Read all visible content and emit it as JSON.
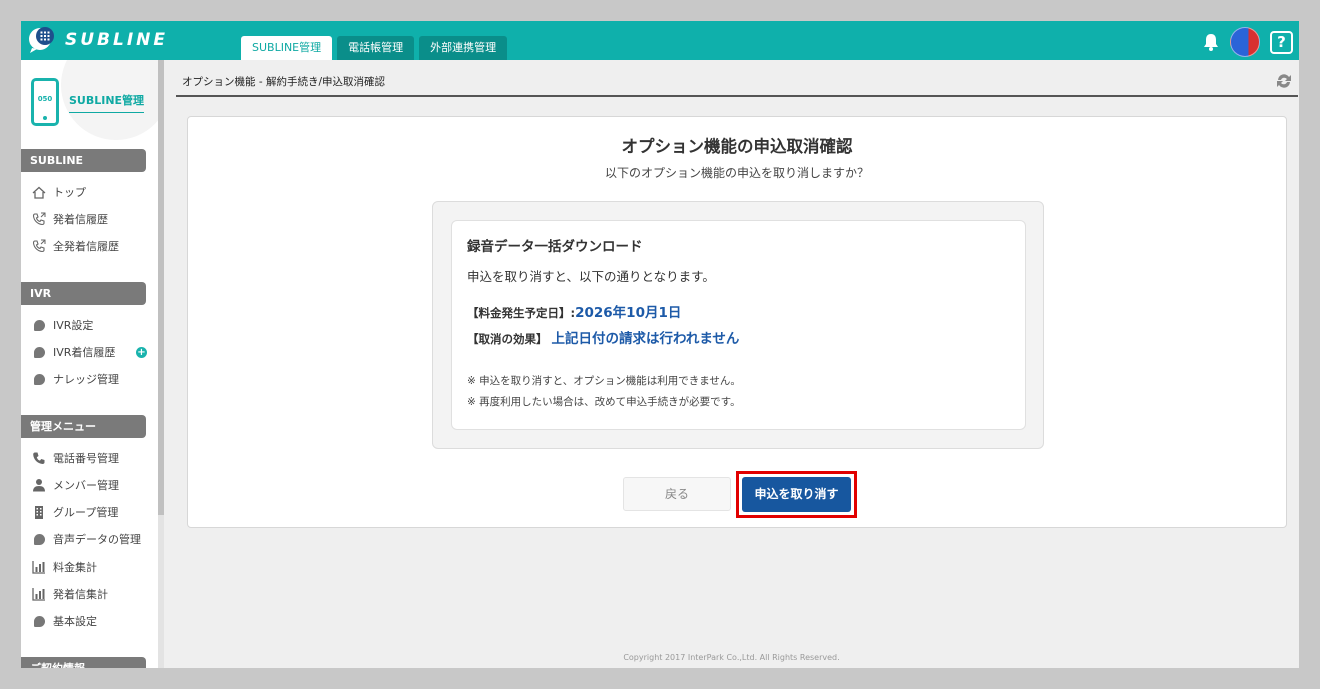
{
  "app": {
    "logo_text": "SUBLINE",
    "tabs": [
      {
        "label": "SUBLINE管理",
        "active": true
      },
      {
        "label": "電話帳管理",
        "active": false
      },
      {
        "label": "外部連携管理",
        "active": false
      }
    ],
    "help_label": "?"
  },
  "sidebar": {
    "brand_number": "050",
    "brand_label": "SUBLINE管理",
    "sections": [
      {
        "header": "SUBLINE",
        "items": [
          {
            "label": "トップ",
            "icon": "home-icon"
          },
          {
            "label": "発着信履歴",
            "icon": "phone-call-icon"
          },
          {
            "label": "全発着信履歴",
            "icon": "phone-call-icon"
          }
        ]
      },
      {
        "header": "IVR",
        "items": [
          {
            "label": "IVR設定",
            "icon": "bubble-icon"
          },
          {
            "label": "IVR着信履歴",
            "icon": "bubble-icon"
          },
          {
            "label": "ナレッジ管理",
            "icon": "bubble-icon"
          }
        ]
      },
      {
        "header": "管理メニュー",
        "items": [
          {
            "label": "電話番号管理",
            "icon": "phone-icon"
          },
          {
            "label": "メンバー管理",
            "icon": "person-icon"
          },
          {
            "label": "グループ管理",
            "icon": "building-icon"
          },
          {
            "label": "音声データの管理",
            "icon": "bubble-icon"
          },
          {
            "label": "料金集計",
            "icon": "bar-chart-icon"
          },
          {
            "label": "発着信集計",
            "icon": "bar-chart-icon"
          },
          {
            "label": "基本設定",
            "icon": "bubble-icon"
          }
        ]
      },
      {
        "header": "ご契約情報"
      }
    ]
  },
  "breadcrumb": "オプション機能 - 解約手続き/申込取消確認",
  "dialog": {
    "title": "オプション機能の申込取消確認",
    "subtitle": "以下のオプション機能の申込を取り消しますか？",
    "card": {
      "title": "録音データ一括ダウンロード",
      "description": "申込を取り消すと、以下の通りとなります。",
      "fields": [
        {
          "key": "【料金発生予定日】:",
          "value": "2026年10月1日"
        },
        {
          "key": "【取消の効果】",
          "value": "上記日付の請求は行われません"
        }
      ],
      "notes": [
        "※ 申込を取り消すと、オプション機能は利用できません。",
        "※ 再度利用したい場合は、改めて申込手続きが必要です。"
      ]
    },
    "back_label": "戻る",
    "cancel_label": "申込を取り消す"
  },
  "footer": "Copyright 2017 InterPark Co.,Ltd. All Rights Reserved.",
  "colors": {
    "brand": "#0fb0ab",
    "primary": "#17579f",
    "highlight": "#e10000"
  }
}
